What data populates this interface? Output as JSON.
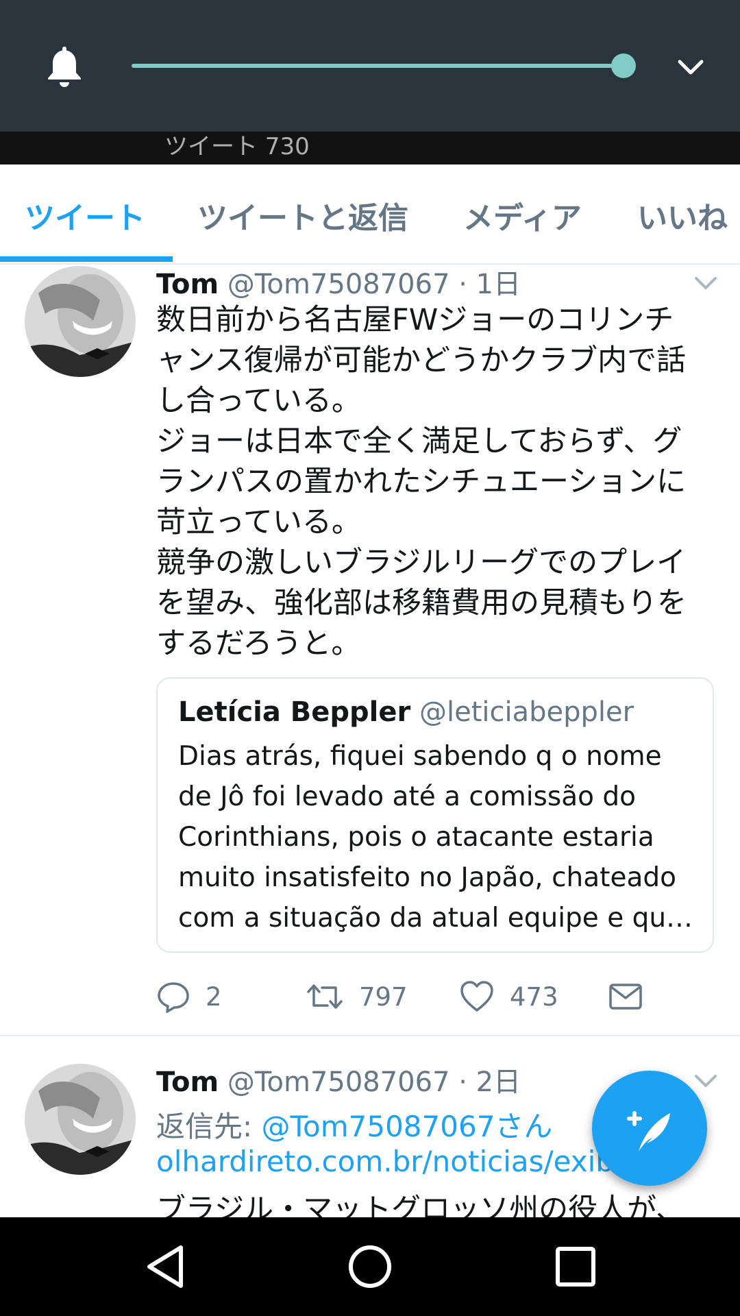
{
  "status_panel": {
    "volume_level": 1.0,
    "icons": [
      "bell-icon",
      "chevron-down-icon"
    ]
  },
  "profile_header": {
    "tweet_count_partial": "ツイート 730"
  },
  "tabs": [
    {
      "label": "ツイート",
      "active": true
    },
    {
      "label": "ツイートと返信",
      "active": false
    },
    {
      "label": "メディア",
      "active": false
    },
    {
      "label": "いいね",
      "active": false
    }
  ],
  "tweets": [
    {
      "name": "Tom",
      "handle": "@Tom75087067",
      "time": "· 1日",
      "text_lines": [
        "数日前から名古屋FWジョーのコリンチ",
        "ャンス復帰が可能かどうかクラブ内で話",
        "し合っている。",
        "ジョーは日本で全く満足しておらず、グ",
        "ランパスの置かれたシチュエーションに",
        "苛立っている。",
        "競争の激しいブラジルリーグでのプレイ",
        "を望み、強化部は移籍費用の見積もりを",
        "するだろうと。"
      ],
      "quote": {
        "name": "Letícia Beppler",
        "handle": "@leticiabeppler",
        "text_lines": [
          "Dias atrás, fiquei sabendo q o nome",
          "de Jô foi levado até a comissão do",
          "Corinthians, pois o atacante estaria",
          "muito insatisfeito no Japão, chateado",
          "com a situação da atual equipe e qu…"
        ]
      },
      "actions": {
        "replies": "2",
        "retweets": "797",
        "likes": "473"
      }
    },
    {
      "name": "Tom",
      "handle": "@Tom75087067",
      "time": "· 2日",
      "reply_prefix": "返信先: ",
      "reply_to": "@Tom75087067さん",
      "link": "olhardireto.com.br/noticias/exibi...",
      "text_partial": "ブラジル・マットグロッソ州の役人が、"
    }
  ],
  "colors": {
    "accent": "#1da1f2",
    "panel": "#2a343d",
    "slider": "#80cbc4",
    "secondary_text": "#657786"
  }
}
